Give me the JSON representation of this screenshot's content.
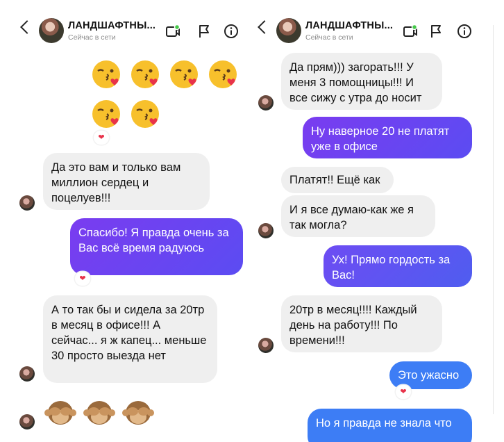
{
  "header": {
    "title": "ЛАНДШАФТНЫ...",
    "status": "Сейчас в сети"
  },
  "left": {
    "emoji_kiss_count": 6,
    "emoji_monkey_count": 3,
    "messages": [
      {
        "text": "Да это вам и только вам миллион сердец и поцелуев!!!"
      },
      {
        "text": "Спасибо! Я правда очень за Вас всё время радуюсь"
      },
      {
        "text": "А то так бы и сидела за 20тр в месяц в офисе!!! А сейчас... я ж капец... меньше 30 просто выезда нет"
      }
    ]
  },
  "right": {
    "messages": [
      {
        "text": "Да прям))) загорать!!! У меня 3 помощницы!!! И все сижу с утра до носит"
      },
      {
        "text": "Ну наверное 20 не платят уже в офисе"
      },
      {
        "text": "Платят!! Ещё как"
      },
      {
        "text": "И я все думаю-как же я так могла?"
      },
      {
        "text": "Ух! Прямо гордость за Вас!"
      },
      {
        "text": "20тр в месяц!!!! Каждый день на работу!!! По времени!!!"
      },
      {
        "text": "Это ужасно"
      },
      {
        "text": "Но я правда не знала что"
      }
    ]
  },
  "reaction": "❤",
  "colors": {
    "incoming_bg": "#efefef",
    "outgoing_purple": "#7a3cf0",
    "outgoing_violet": "#5b4cf2",
    "outgoing_blue": "#3d7df5"
  }
}
